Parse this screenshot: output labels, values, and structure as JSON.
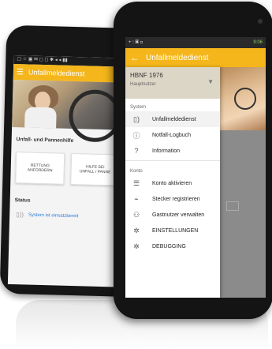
{
  "back_phone": {
    "app_title": "Unfallmeldedienst",
    "section_title": "Unfall- und Pannenhilfe",
    "buttons": [
      {
        "label": "RETTUNG\nANFORDERN"
      },
      {
        "label": "HILFE BEI\nUNFALL / PANNE"
      }
    ],
    "status_label": "Status",
    "status_text": "System ist einsatzbereit"
  },
  "front_phone": {
    "status_time": "9:06",
    "app_title": "Unfallmeldedienst",
    "drawer": {
      "account_name": "HBNF 1976",
      "account_role": "Hauptnutzer",
      "sections": [
        {
          "title": "System",
          "items": [
            {
              "label": "Unfallmeldedienst",
              "icon": "phone-signal-icon"
            },
            {
              "label": "Notfall-Logbuch",
              "icon": "info-circle-icon"
            },
            {
              "label": "Information",
              "icon": "question-icon"
            }
          ]
        },
        {
          "title": "Konto",
          "items": [
            {
              "label": "Konto aktivieren",
              "icon": "list-icon"
            },
            {
              "label": "Stecker registrieren",
              "icon": "plug-icon"
            },
            {
              "label": "Gastnutzer verwalten",
              "icon": "users-icon"
            },
            {
              "label": "EINSTELLUNGEN",
              "icon": "gear-icon"
            },
            {
              "label": "DEBUGGING",
              "icon": "gear-icon"
            }
          ]
        }
      ]
    }
  }
}
